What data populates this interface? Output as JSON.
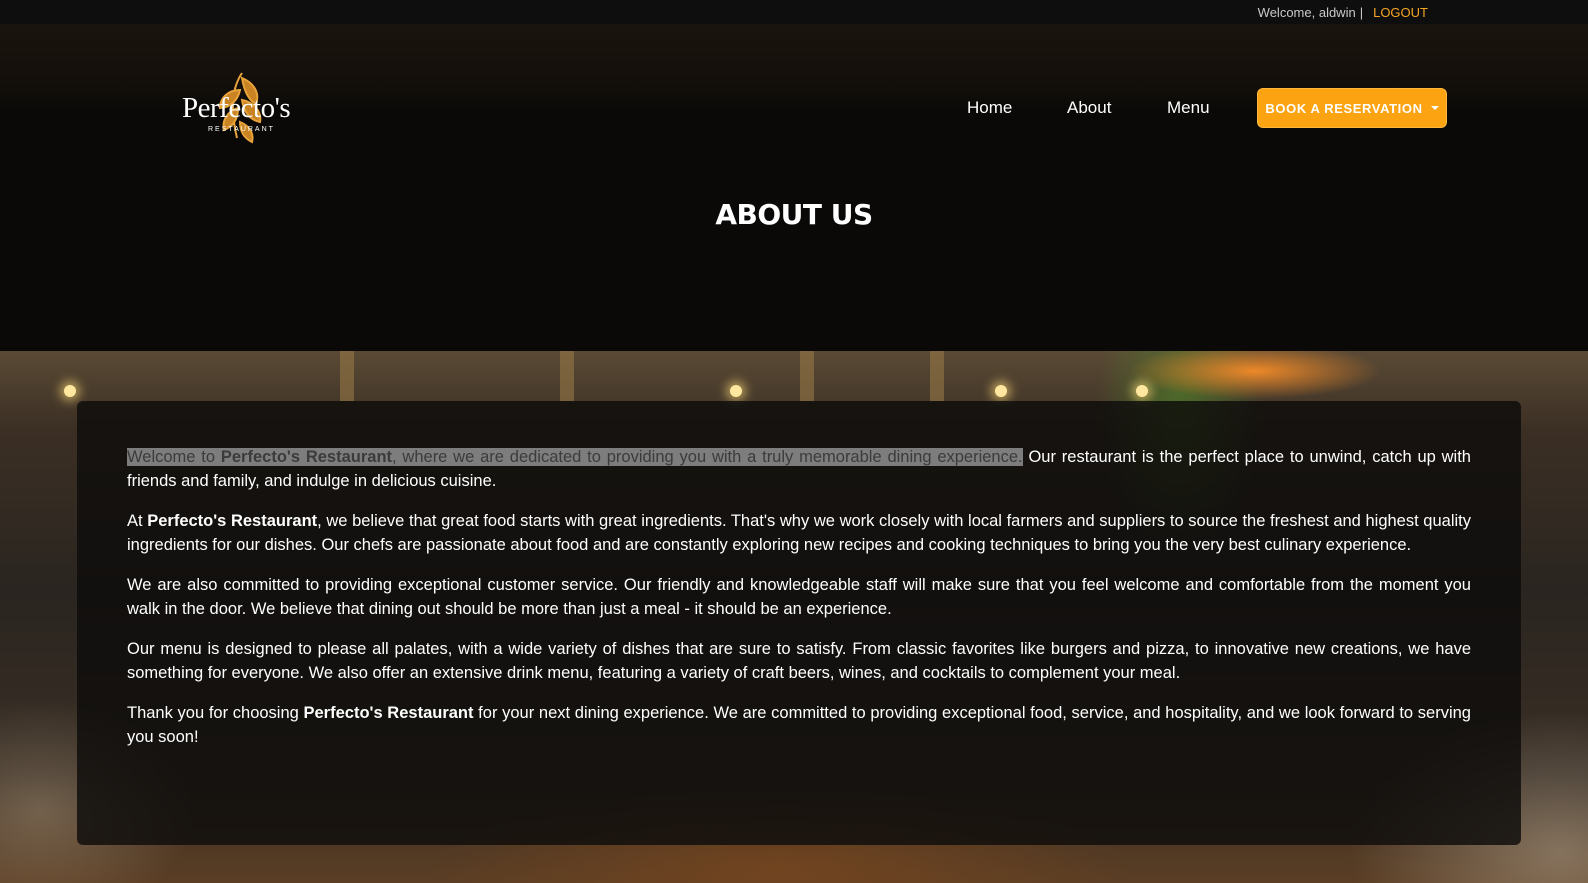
{
  "topbar": {
    "welcome": "Welcome, aldwin",
    "separator": "|",
    "logout": "LOGOUT"
  },
  "logo": {
    "name": "Perfecto's",
    "tagline": "RESTAURANT"
  },
  "nav": {
    "items": [
      {
        "label": "Home"
      },
      {
        "label": "About"
      },
      {
        "label": "Menu"
      }
    ],
    "cta": "BOOK A RESERVATION"
  },
  "page": {
    "title": "ABOUT US"
  },
  "about": {
    "p1_hl_a": "Welcome to ",
    "p1_hl_bold": "Perfecto's Restaurant",
    "p1_hl_b": ", where we are dedicated to providing you with a truly memorable dining experience.",
    "p1_rest": " Our restaurant is the perfect place to unwind, catch up with friends and family, and indulge in delicious cuisine.",
    "p2_a": "At ",
    "p2_bold": "Perfecto's Restaurant",
    "p2_b": ", we believe that great food starts with great ingredients. That's why we work closely with local farmers and suppliers to source the freshest and highest quality ingredients for our dishes. Our chefs are passionate about food and are constantly exploring new recipes and cooking techniques to bring you the very best culinary experience.",
    "p3": "We are also committed to providing exceptional customer service. Our friendly and knowledgeable staff will make sure that you feel welcome and comfortable from the moment you walk in the door. We believe that dining out should be more than just a meal - it should be an experience.",
    "p4": "Our menu is designed to please all palates, with a wide variety of dishes that are sure to satisfy. From classic favorites like burgers and pizza, to innovative new creations, we have something for everyone. We also offer an extensive drink menu, featuring a variety of craft beers, wines, and cocktails to complement your meal.",
    "p5_a": "Thank you for choosing ",
    "p5_bold": "Perfecto's Restaurant",
    "p5_b": " for your next dining experience. We are committed to providing exceptional food, service, and hospitality, and we look forward to serving you soon!"
  },
  "colors": {
    "accent": "#fca311",
    "background": "#0a0908"
  }
}
